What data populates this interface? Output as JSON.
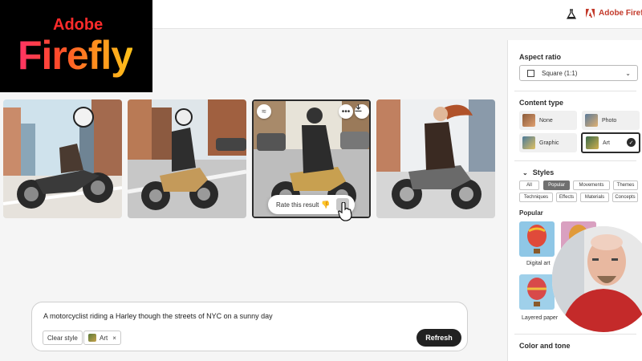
{
  "header": {
    "brand": "Adobe Firefly (",
    "labs_icon": "flask-icon",
    "brand_icon": "adobe-logo-icon"
  },
  "logo": {
    "adobe": "Adobe",
    "firefly": "Firefly"
  },
  "results": {
    "rate_label": "Rate this result",
    "overlay_icons": [
      "style-match-icon",
      "more-icon",
      "download-icon"
    ]
  },
  "prompt": {
    "text": "A motorcyclist riding a Harley though the streets of NYC on a sunny day",
    "clear_style": "Clear style",
    "style_chip": "Art",
    "remove": "×",
    "refresh": "Refresh"
  },
  "panel": {
    "aspect_ratio_title": "Aspect ratio",
    "aspect_ratio_value": "Square (1:1)",
    "content_type_title": "Content type",
    "content_types": [
      "None",
      "Photo",
      "Graphic",
      "Art"
    ],
    "selected_content_type": "Art",
    "styles_title": "Styles",
    "style_tabs": [
      "All",
      "Popular",
      "Movements",
      "Themes",
      "Techniques",
      "Effects",
      "Materials",
      "Concepts"
    ],
    "active_style_tab": "Popular",
    "popular_title": "Popular",
    "popular_styles": [
      "Digital art",
      "Layered paper"
    ],
    "color_tone_title": "Color and tone"
  },
  "colors": {
    "accent": "#c33a2b",
    "dark": "#2c2c2c",
    "active_tab": "#707070"
  }
}
